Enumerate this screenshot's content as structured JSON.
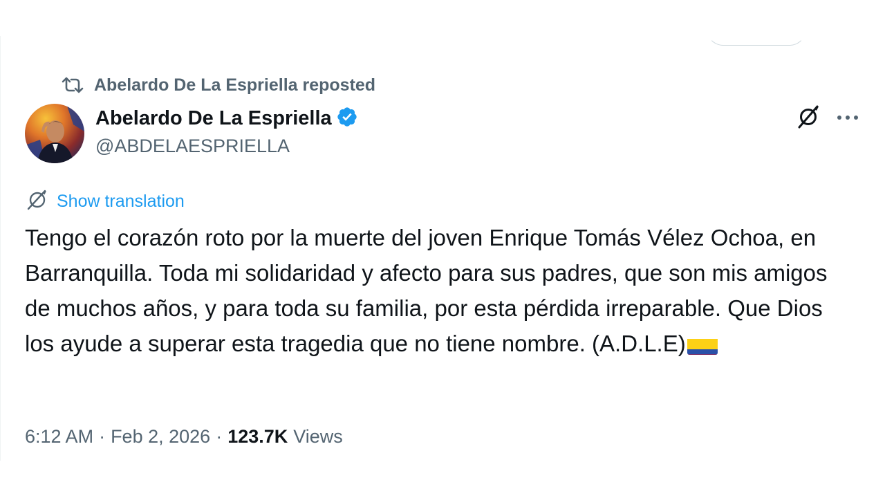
{
  "repost": {
    "label": "Abelardo De La Espriella reposted",
    "icon": "repost-icon"
  },
  "author": {
    "display_name": "Abelardo De La Espriella",
    "handle": "@ABDELAESPRIELLA",
    "verified": true,
    "verified_color": "#1d9bf0"
  },
  "actions": {
    "grok_icon": "grok-icon",
    "more_icon": "more-icon"
  },
  "translation": {
    "label": "Show translation",
    "icon": "translate-icon"
  },
  "tweet": {
    "text": "Tengo el corazón roto por la muerte del joven Enrique Tomás Vélez Ochoa, en Barranquilla. Toda mi solidaridad y afecto para sus padres, que son mis amigos de muchos años, y para toda su familia, por esta pérdida irreparable. Que Dios los ayude a superar esta tragedia que no tiene nombre. (A.D.L.E)",
    "emoji": "colombia-flag-icon"
  },
  "meta": {
    "time": "6:12 AM",
    "separator": "·",
    "date": "Feb 2, 2026",
    "views_count": "123.7K",
    "views_label": "Views"
  },
  "colors": {
    "text_primary": "#0f1419",
    "text_secondary": "#536471",
    "link": "#1d9bf0",
    "border": "#cfd9de"
  }
}
